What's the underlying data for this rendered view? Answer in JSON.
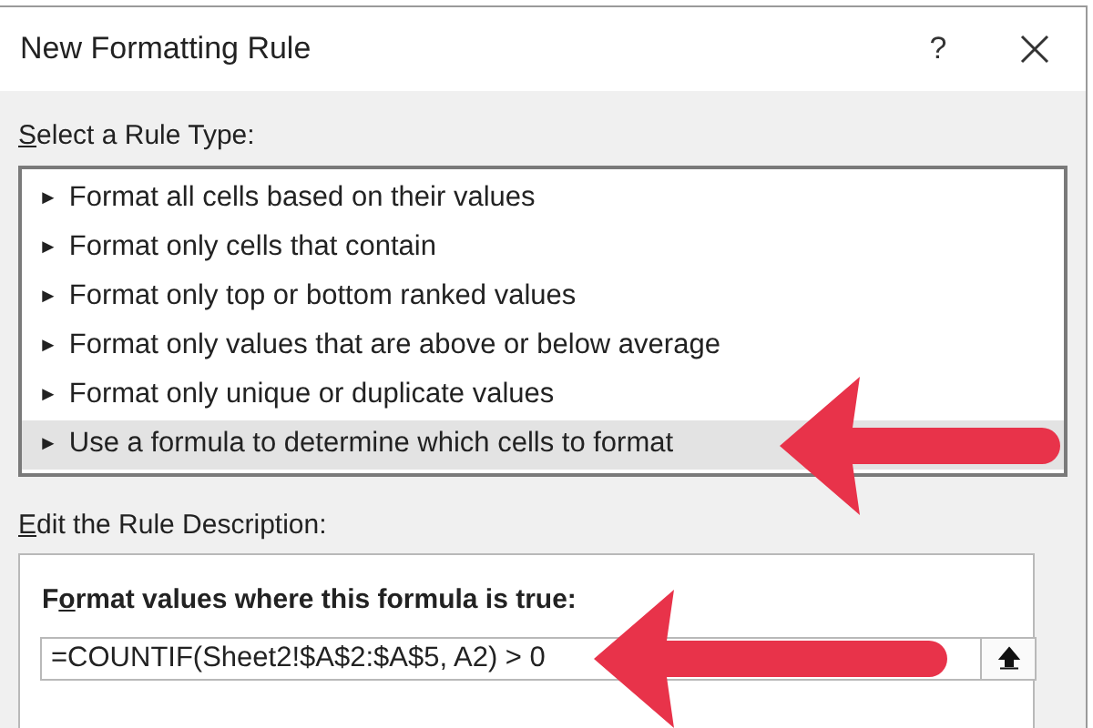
{
  "window": {
    "title": "New Formatting Rule",
    "help": "?"
  },
  "rule_type": {
    "label": {
      "key": "S",
      "after": "elect a Rule Type:"
    },
    "items": [
      {
        "marker": "►",
        "label": "Format all cells based on their values",
        "selected": false
      },
      {
        "marker": "►",
        "label": "Format only cells that contain",
        "selected": false
      },
      {
        "marker": "►",
        "label": "Format only top or bottom ranked values",
        "selected": false
      },
      {
        "marker": "►",
        "label": "Format only values that are above or below average",
        "selected": false
      },
      {
        "marker": "►",
        "label": "Format only unique or duplicate values",
        "selected": false
      },
      {
        "marker": "►",
        "label": "Use a formula to determine which cells to format",
        "selected": true
      }
    ]
  },
  "description": {
    "label": {
      "key": "E",
      "after": "dit the Rule Description:"
    },
    "formula_label": {
      "before": "F",
      "key": "o",
      "after": "rmat values where this formula is true:"
    },
    "formula": {
      "value": "=COUNTIF(Sheet2!$A$2:$A$5, A2) > 0"
    }
  }
}
